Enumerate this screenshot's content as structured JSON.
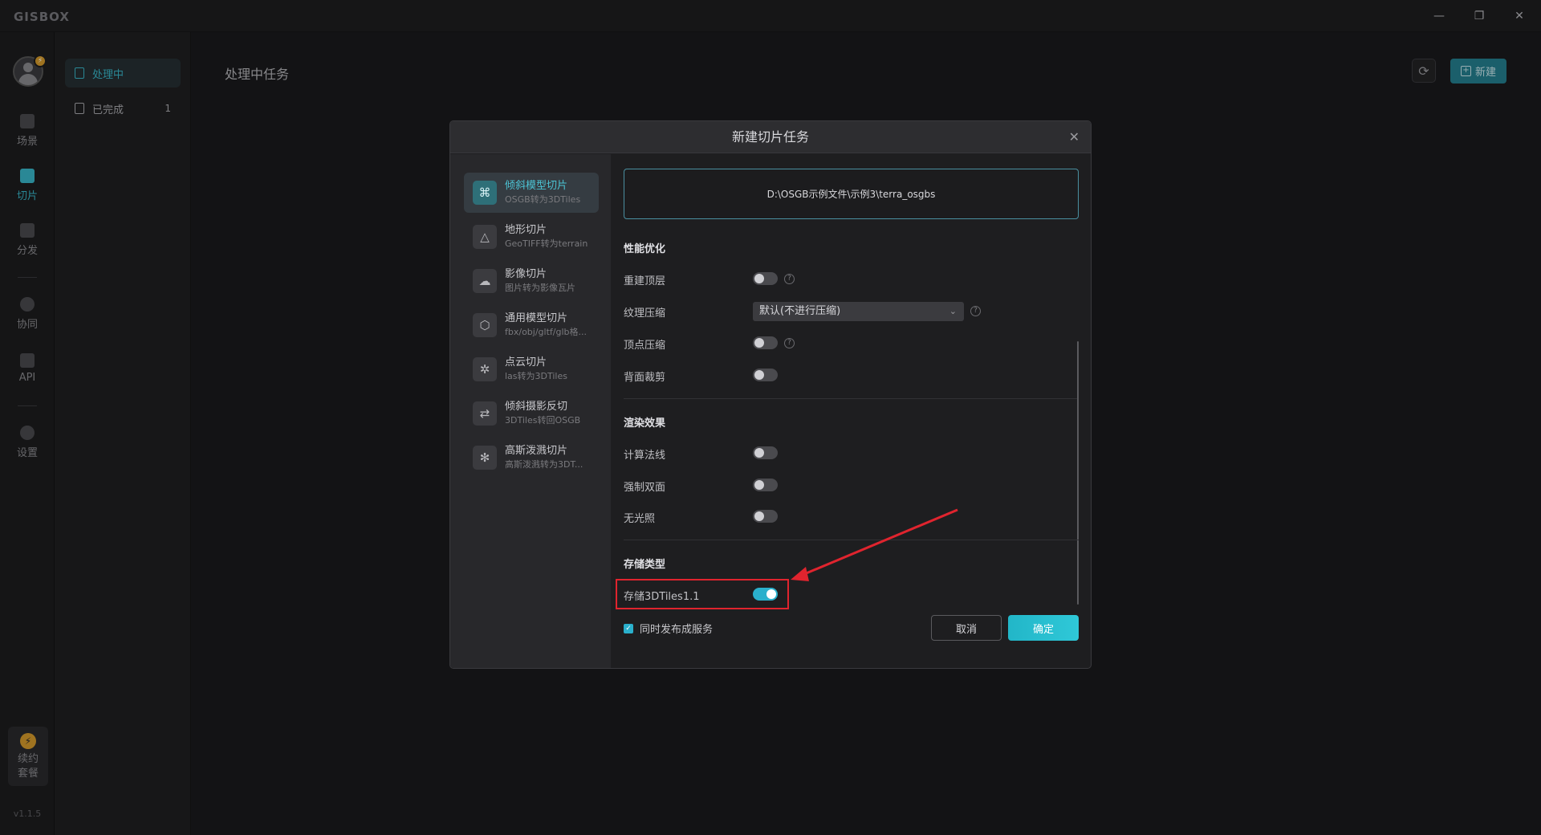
{
  "app": {
    "logo": "GISBOX",
    "version": "v1.1.5"
  },
  "window": {
    "minimize": "—",
    "restore": "❐",
    "close": "✕"
  },
  "rail": {
    "avatar_badge": "⚡",
    "items": [
      {
        "label": "场景",
        "icon": "home-icon"
      },
      {
        "label": "切片",
        "icon": "slice-icon",
        "active": true
      },
      {
        "label": "分发",
        "icon": "share-icon"
      },
      {
        "label": "协同",
        "icon": "lock-icon"
      },
      {
        "label": "API",
        "icon": "api-icon"
      },
      {
        "label": "设置",
        "icon": "gear-icon"
      }
    ],
    "renew": {
      "line1": "续约",
      "line2": "套餐",
      "icon": "⚡"
    }
  },
  "subnav": {
    "items": [
      {
        "label": "处理中",
        "active": true
      },
      {
        "label": "已完成",
        "count": "1"
      }
    ]
  },
  "main": {
    "title": "处理中任务",
    "refresh_icon": "⟳",
    "new_label": "新建",
    "new_icon": "+"
  },
  "modal": {
    "title": "新建切片任务",
    "close": "✕",
    "types": [
      {
        "name": "倾斜模型切片",
        "sub": "OSGB转为3DTiles",
        "icon": "⌘",
        "active": true
      },
      {
        "name": "地形切片",
        "sub": "GeoTIFF转为terrain",
        "icon": "△"
      },
      {
        "name": "影像切片",
        "sub": "图片转为影像瓦片",
        "icon": "☁"
      },
      {
        "name": "通用模型切片",
        "sub": "fbx/obj/gltf/glb格...",
        "icon": "⬡"
      },
      {
        "name": "点云切片",
        "sub": "las转为3DTiles",
        "icon": "✲"
      },
      {
        "name": "倾斜摄影反切",
        "sub": "3DTiles转回OSGB",
        "icon": "⇄"
      },
      {
        "name": "高斯泼溅切片",
        "sub": "高斯泼溅转为3DT...",
        "icon": "✻"
      }
    ],
    "path": "D:\\OSGB示例文件\\示例3\\terra_osgbs",
    "sections": {
      "perf": "性能优化",
      "render": "渲染效果",
      "storage": "存储类型"
    },
    "rows": {
      "rebuild_top": "重建顶层",
      "texture_compress": "纹理压缩",
      "vertex_compress": "顶点压缩",
      "backface_cull": "背面裁剪",
      "compute_normals": "计算法线",
      "double_sided": "强制双面",
      "no_lighting": "无光照",
      "store_3dtiles11": "存储3DTiles1.1"
    },
    "texture_select": {
      "value": "默认(不进行压缩)",
      "caret": "⌄"
    },
    "help": "?",
    "publish_label": "同时发布成服务",
    "publish_check": "✓",
    "cancel": "取消",
    "ok": "确定"
  }
}
